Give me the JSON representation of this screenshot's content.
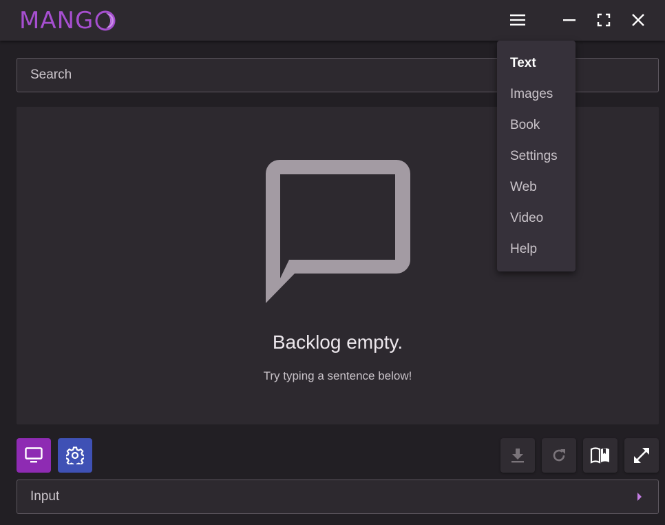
{
  "app": {
    "logo_text": "MANG",
    "logo_accent_color": "#a64fd0"
  },
  "titlebar": {
    "menu_icon": "hamburger-icon",
    "minimize_icon": "minimize-icon",
    "fullscreen_icon": "fullscreen-icon",
    "close_icon": "close-icon"
  },
  "search": {
    "placeholder": "Search",
    "value": ""
  },
  "backlog": {
    "icon": "chat-bubble-icon",
    "empty_title": "Backlog empty.",
    "empty_subtitle": "Try typing a sentence below!"
  },
  "menu": {
    "items": [
      {
        "label": "Text",
        "active": true
      },
      {
        "label": "Images",
        "active": false
      },
      {
        "label": "Book",
        "active": false
      },
      {
        "label": "Settings",
        "active": false
      },
      {
        "label": "Web",
        "active": false
      },
      {
        "label": "Video",
        "active": false
      },
      {
        "label": "Help",
        "active": false
      }
    ]
  },
  "toolbar": {
    "left": [
      {
        "icon": "monitor-icon",
        "color": "#8e2bb3"
      },
      {
        "icon": "gear-icon",
        "color": "#3f51b5"
      }
    ],
    "right": [
      {
        "icon": "download-icon",
        "enabled": false
      },
      {
        "icon": "refresh-icon",
        "enabled": false
      },
      {
        "icon": "book-icon",
        "enabled": true
      },
      {
        "icon": "expand-icon",
        "enabled": true
      }
    ]
  },
  "input": {
    "placeholder": "Input",
    "value": "",
    "send_icon": "arrow-right-icon"
  }
}
